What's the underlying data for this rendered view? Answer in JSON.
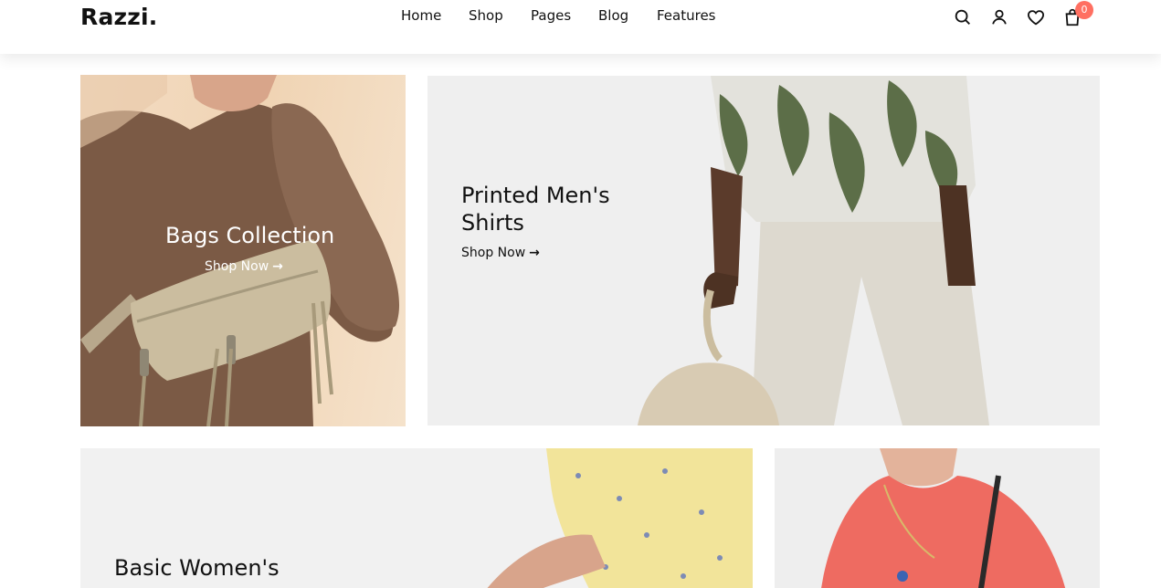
{
  "header": {
    "logo": "Razzi.",
    "nav": [
      "Home",
      "Shop",
      "Pages",
      "Blog",
      "Features"
    ],
    "icons": [
      "search-icon",
      "user-icon",
      "heart-icon",
      "bag-icon"
    ],
    "cart_count": "0",
    "badge_color": "#ff6f61"
  },
  "banners": [
    {
      "title": "Bags Collection",
      "link": "Shop Now",
      "arrow": "→"
    },
    {
      "title_line1": "Printed Men's",
      "title_line2": "Shirts",
      "link": "Shop Now",
      "arrow": "→"
    },
    {
      "title_line1": "Basic Women's"
    },
    {}
  ]
}
